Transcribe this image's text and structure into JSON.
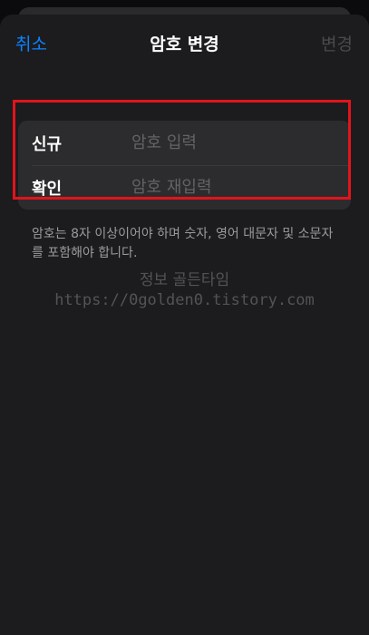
{
  "nav": {
    "cancel_label": "취소",
    "title": "암호 변경",
    "done_label": "변경"
  },
  "form": {
    "rows": [
      {
        "label": "신규",
        "placeholder": "암호 입력",
        "value": ""
      },
      {
        "label": "확인",
        "placeholder": "암호 재입력",
        "value": ""
      }
    ]
  },
  "hint": "암호는 8자 이상이어야 하며 숫자, 영어 대문자 및 소문자를 포함해야 합니다.",
  "watermark": {
    "line1": "정보 골든타임",
    "line2": "https://0golden0.tistory.com"
  },
  "colors": {
    "accent": "#0a84ff",
    "disabled": "#4a4a4e",
    "highlight_border": "#e2141b",
    "sheet_background": "#1c1c1e",
    "group_background": "#2c2c2e"
  }
}
